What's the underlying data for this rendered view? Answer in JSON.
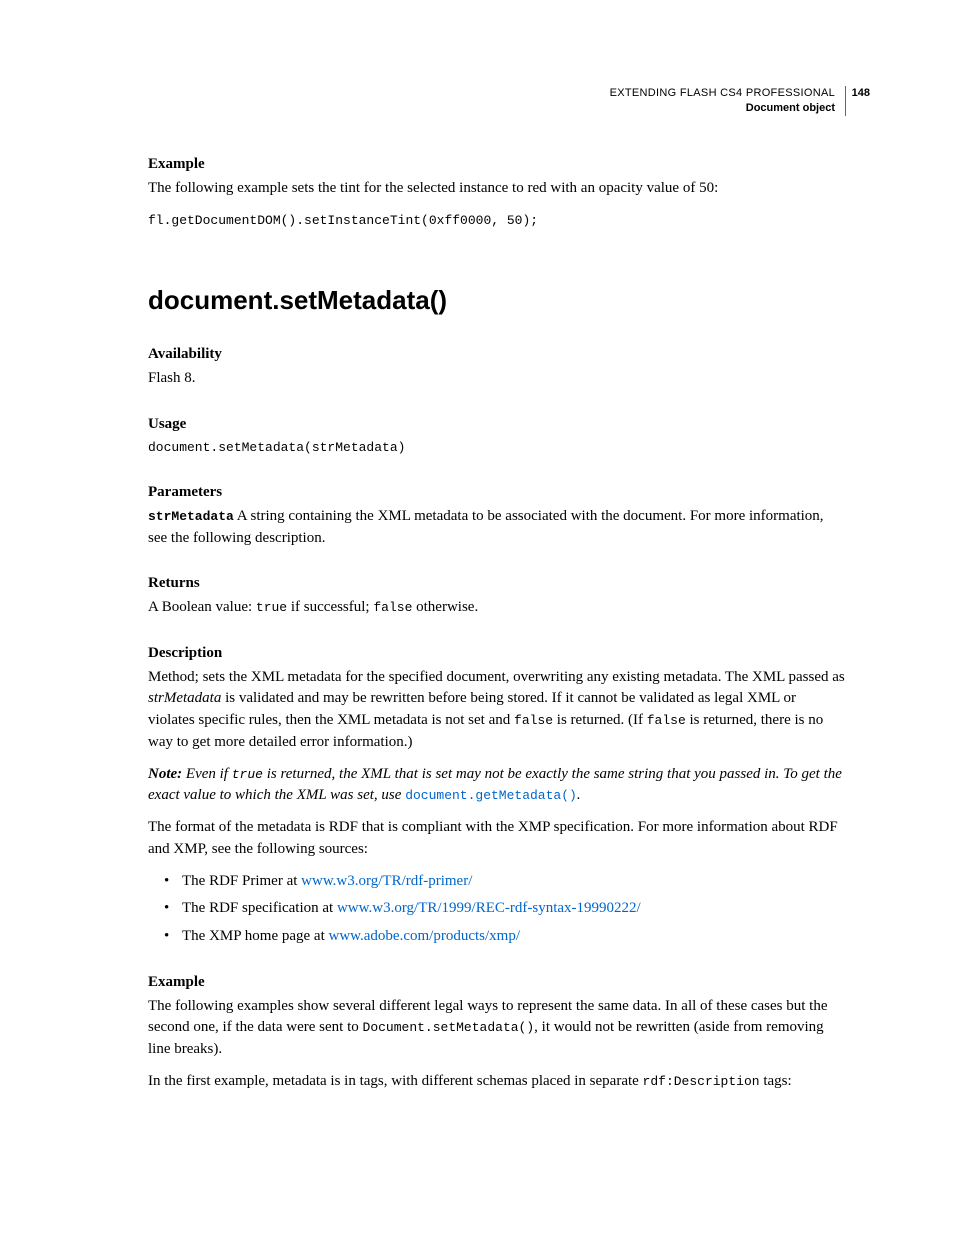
{
  "header": {
    "title": "EXTENDING FLASH CS4 PROFESSIONAL",
    "subtitle": "Document object",
    "page": "148"
  },
  "top_example": {
    "heading": "Example",
    "text": "The following example sets the tint for the selected instance to red with an opacity value of 50:",
    "code": "fl.getDocumentDOM().setInstanceTint(0xff0000, 50);"
  },
  "method_title": "document.setMetadata()",
  "availability": {
    "heading": "Availability",
    "text": "Flash 8."
  },
  "usage": {
    "heading": "Usage",
    "code": "document.setMetadata(strMetadata)"
  },
  "parameters": {
    "heading": "Parameters",
    "param_name": "strMetadata",
    "param_text": "  A string containing the XML metadata to be associated with the document. For more information, see the following description."
  },
  "returns": {
    "heading": "Returns",
    "pre": "A Boolean value: ",
    "true": "true",
    "mid": " if successful; ",
    "false": "false",
    "post": " otherwise."
  },
  "description": {
    "heading": "Description",
    "p1a": "Method; sets the XML metadata for the specified document, overwriting any existing metadata. The XML passed as ",
    "p1b": "strMetadata",
    "p1c": " is validated and may be rewritten before being stored. If it cannot be validated as legal XML or violates specific rules, then the XML metadata is not set and ",
    "p1d": "false",
    "p1e": " is returned. (If ",
    "p1f": "false",
    "p1g": " is returned, there is no way to get more detailed error information.)"
  },
  "note": {
    "label": "Note:",
    "a": " Even if ",
    "true": "true",
    "b": " is returned, the XML that is set may not be exactly the same string that you passed in. To get the exact value to which the XML was set, use ",
    "link": "document.getMetadata()",
    "c": "."
  },
  "format_intro": "The format of the metadata is RDF that is compliant with the XMP specification. For more information about RDF and XMP, see the following sources:",
  "bullets": [
    {
      "pre": "The RDF Primer at ",
      "link": "www.w3.org/TR/rdf-primer/"
    },
    {
      "pre": "The RDF specification at ",
      "link": "www.w3.org/TR/1999/REC-rdf-syntax-19990222/"
    },
    {
      "pre": "The XMP home page at ",
      "link": "www.adobe.com/products/xmp/"
    }
  ],
  "example2": {
    "heading": "Example",
    "p1a": "The following examples show several different legal ways to represent the same data. In all of these cases but the second one, if the data were sent to ",
    "p1b": "Document.setMetadata()",
    "p1c": ", it would not be rewritten (aside from removing line breaks).",
    "p2a": "In the first example, metadata is in tags, with different schemas placed in separate ",
    "p2b": "rdf:Description",
    "p2c": " tags:"
  }
}
